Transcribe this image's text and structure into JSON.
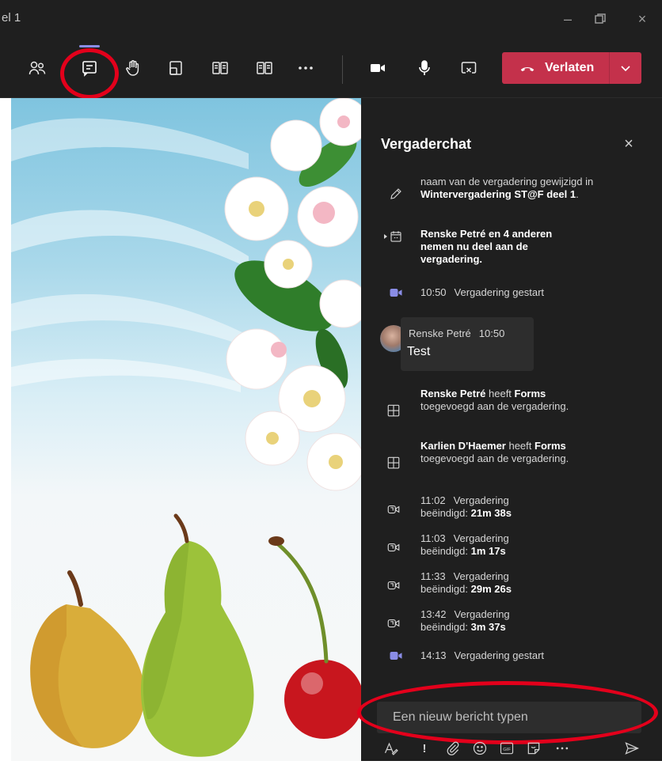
{
  "window": {
    "title": "el 1"
  },
  "toolbar": {
    "leave_label": "Verlaten"
  },
  "chat": {
    "title": "Vergaderchat",
    "events": {
      "rename": {
        "text": "naam van de vergadering gewijzigd in ",
        "bold": "Wintervergadering ST@F deel 1",
        "end": "."
      },
      "joined": {
        "bold": "Renske Petré",
        "text": " en 4 anderen nemen nu deel aan de vergadering."
      },
      "start1": {
        "time": "10:50",
        "text": "Vergadering gestart"
      },
      "forms1": {
        "bold1": "Renske Petré",
        "text1": " heeft ",
        "bold2": "Forms",
        "text2": " toegevoegd aan de vergadering."
      },
      "forms2": {
        "bold1": "Karlien D'Haemer",
        "text1": " heeft ",
        "bold2": "Forms",
        "text2": " toegevoegd aan de vergadering."
      },
      "end1": {
        "time": "11:02",
        "text": "Vergadering",
        "label": "beëindigd: ",
        "dur": "21m 38s"
      },
      "end2": {
        "time": "11:03",
        "text": "Vergadering",
        "label": "beëindigd: ",
        "dur": "1m 17s"
      },
      "end3": {
        "time": "11:33",
        "text": "Vergadering",
        "label": "beëindigd: ",
        "dur": "29m 26s"
      },
      "end4": {
        "time": "13:42",
        "text": "Vergadering",
        "label": "beëindigd: ",
        "dur": "3m 37s"
      },
      "start2": {
        "time": "14:13",
        "text": "Vergadering gestart"
      }
    },
    "message": {
      "author": "Renske Petré",
      "time": "10:50",
      "text": "Test"
    },
    "compose": {
      "placeholder": "Een nieuw bericht typen"
    }
  },
  "colors": {
    "leave": "#c4314b",
    "accent": "#8a8de6",
    "annotation": "#e3001b"
  },
  "icons": [
    "participants-icon",
    "chat-icon",
    "raise-hand-icon",
    "rooms-icon",
    "apps-icon",
    "apps-icon-2",
    "more-icon",
    "camera-icon",
    "microphone-icon",
    "stop-share-icon",
    "phone-icon",
    "chevron-down-icon",
    "pencil-icon",
    "calendar-icon",
    "video-icon",
    "forms-icon",
    "video-off-icon",
    "format-icon",
    "important-icon",
    "attach-icon",
    "emoji-icon",
    "gif-icon",
    "sticker-icon",
    "send-icon"
  ]
}
